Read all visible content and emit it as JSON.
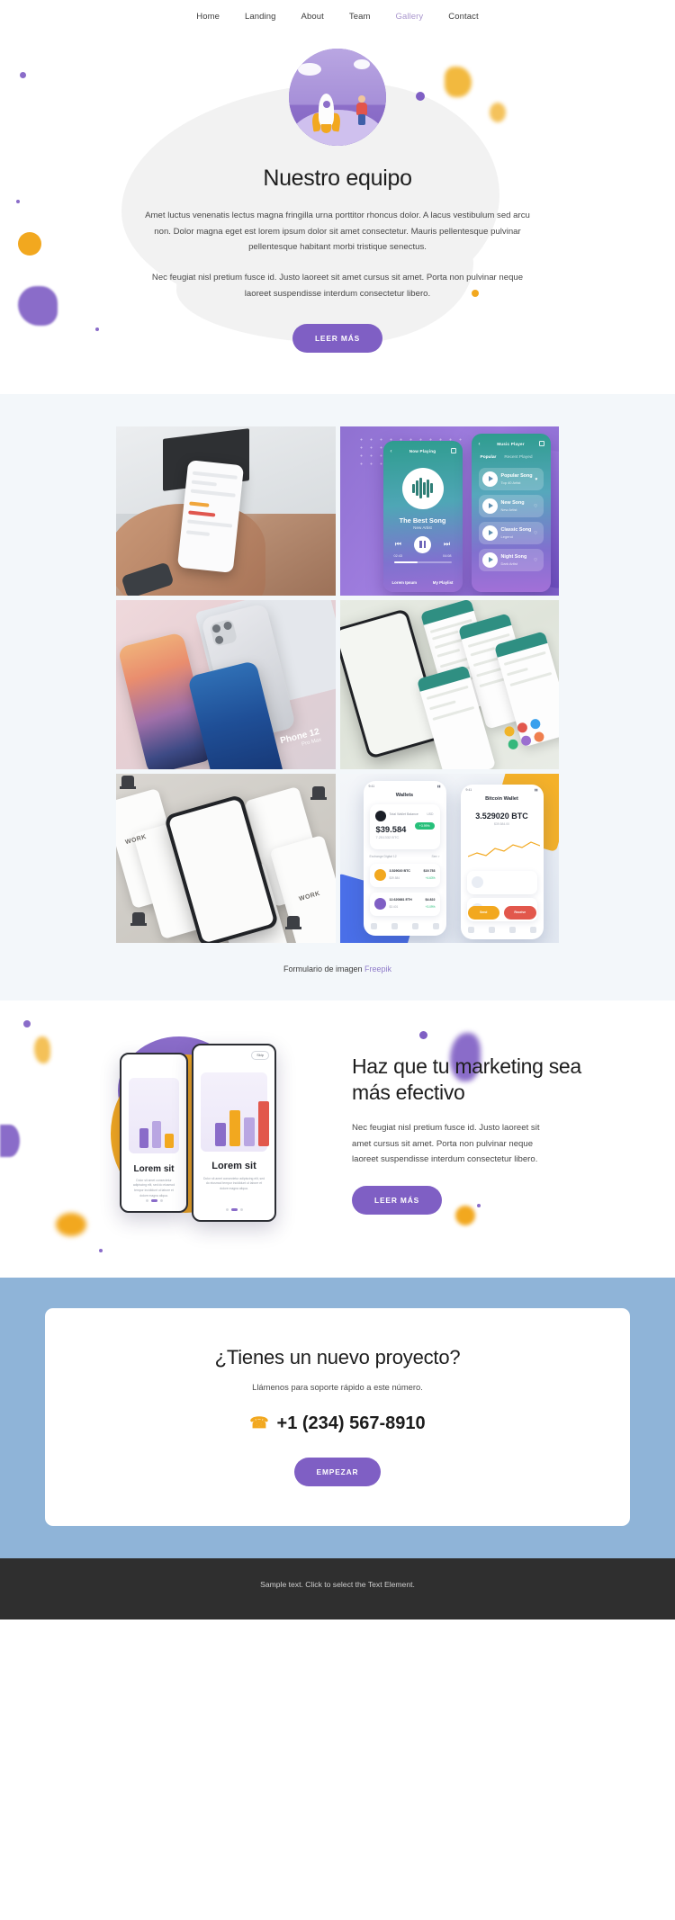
{
  "nav": {
    "items": [
      {
        "label": "Home",
        "active": false
      },
      {
        "label": "Landing",
        "active": false
      },
      {
        "label": "About",
        "active": false
      },
      {
        "label": "Team",
        "active": false
      },
      {
        "label": "Gallery",
        "active": true
      },
      {
        "label": "Contact",
        "active": false
      }
    ]
  },
  "hero": {
    "illustration": "rocket-launch-illustration",
    "title": "Nuestro equipo",
    "paragraph1": "Amet luctus venenatis lectus magna fringilla urna porttitor rhoncus dolor. A lacus vestibulum sed arcu non. Dolor magna eget est lorem ipsum dolor sit amet consectetur. Mauris pellentesque pulvinar pellentesque habitant morbi tristique senectus.",
    "paragraph2": "Nec feugiat nisl pretium fusce id. Justo laoreet sit amet cursus sit amet. Porta non pulvinar neque laoreet suspendisse interdum consectetur libero.",
    "cta_label": "LEER MÁS"
  },
  "gallery": {
    "tiles": [
      {
        "name": "hand-holding-phone-photo",
        "alt": "Hand holding smartphone over desk with laptop"
      },
      {
        "name": "music-player-app-mockup",
        "alt": "Music player app UI mockup on purple background"
      },
      {
        "name": "phones-on-pink-photo",
        "alt": "iPhone 12 Pro Max devices on pink surface"
      },
      {
        "name": "chat-app-screens-photo",
        "alt": "Array of chat app screens perspective mockup"
      },
      {
        "name": "furniture-app-screens-photo",
        "alt": "Furniture shop app screens perspective mockup"
      },
      {
        "name": "crypto-wallet-app-mockup",
        "alt": "Crypto wallet app mockup"
      }
    ],
    "music_player": {
      "screen1": {
        "header": "Now Playing",
        "song_title": "The Best Song",
        "artist": "New Artist",
        "time_elapsed": "02:43",
        "time_total": "04:08",
        "footer_left": "Lorem Ipsum",
        "footer_right": "My Playlist"
      },
      "screen2": {
        "header": "Music Player",
        "tab_active": "Popular",
        "tab_inactive": "Recent Played",
        "items": [
          {
            "title": "Popular Song",
            "subtitle": "Top 40 Artist"
          },
          {
            "title": "New Song",
            "subtitle": "New Artist"
          },
          {
            "title": "Classic Song",
            "subtitle": "Legend"
          },
          {
            "title": "Night Song",
            "subtitle": "Dark Artist"
          }
        ]
      }
    },
    "phones_pink": {
      "device_label": "Phone 12",
      "device_sub": "Pro Max"
    },
    "furniture": {
      "watermark": "WORK"
    },
    "crypto": {
      "screen1": {
        "status_time": "9:41",
        "header": "Wallets",
        "balance_label": "Total Wallet Balance",
        "balance": "$39.584",
        "balance_btc": "7.251332 BTC",
        "change": "+3.99%",
        "unit": "USD",
        "section_label": "Exchange Digital 12",
        "section_action": "See >",
        "rows": [
          {
            "name": "3.529020 BTC",
            "sub": "$39.584",
            "value": "$19.753",
            "delta": "+4.63%"
          },
          {
            "name": "12.620881 ETH",
            "sub": "$3.401",
            "value": "$4.822",
            "delta": "+3.09%"
          }
        ]
      },
      "screen2": {
        "header": "Bitcoin Wallet",
        "balance": "3.529020 BTC",
        "balance_sub": "$39.584.00",
        "action_send": "Send",
        "action_receive": "Receive"
      }
    },
    "credit_prefix": "Formulario de imagen",
    "credit_link": "Freepik"
  },
  "marketing": {
    "title": "Haz que tu marketing sea más efectivo",
    "paragraph": "Nec feugiat nisl pretium fusce id. Justo laoreet sit amet cursus sit amet. Porta non pulvinar neque laoreet suspendisse interdum consectetur libero.",
    "cta_label": "LEER MÁS",
    "phone1": {
      "title": "Lorem sit",
      "body": "Dolor sit amet consectetur adipiscing elit, sed do eiusmod tempor incididunt ut labore et dolore magna aliqua."
    },
    "phone2": {
      "skip_label": "Skip",
      "title": "Lorem sit",
      "body": "Dolor sit amet consectetur adipiscing elit, sed do eiusmod tempor incididunt ut labore et dolore magna aliqua."
    }
  },
  "cta": {
    "title": "¿Tienes un nuevo proyecto?",
    "subtitle": "Llámenos para soporte rápido a este número.",
    "phone": "+1 (234) 567-8910",
    "phone_icon": "phone-icon",
    "button_label": "EMPEZAR"
  },
  "footer": {
    "text": "Sample text. Click to select the Text Element."
  },
  "colors": {
    "purple": "#7f5fc4",
    "purple_light": "#a996cd",
    "orange": "#f2a81f",
    "blue_cta_bg": "#8fb4d8",
    "gallery_bg": "#f3f7fa",
    "footer_bg": "#2f2f2f",
    "hero_blob": "#f2f2f2"
  }
}
